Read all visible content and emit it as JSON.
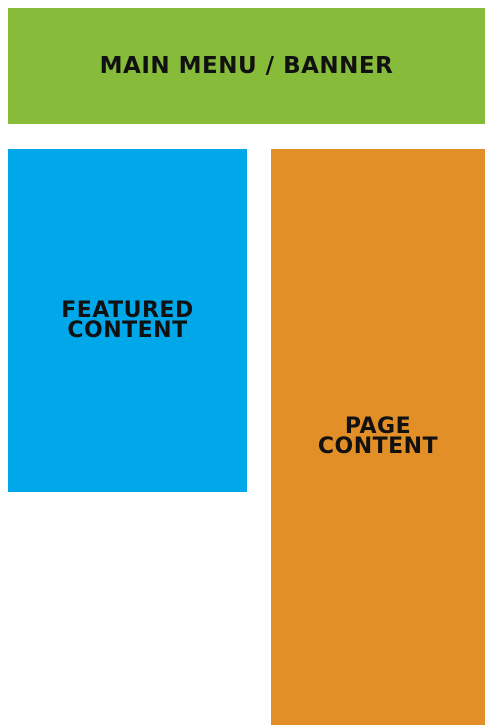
{
  "blocks": {
    "banner": {
      "lines": [
        "MAIN MENU / BANNER"
      ],
      "color": "#87bb3a"
    },
    "featured": {
      "lines": [
        "FEATURED",
        "CONTENT"
      ],
      "color": "#00a8e9"
    },
    "page": {
      "lines": [
        "PAGE",
        "CONTENT"
      ],
      "color": "#e38f27"
    }
  }
}
